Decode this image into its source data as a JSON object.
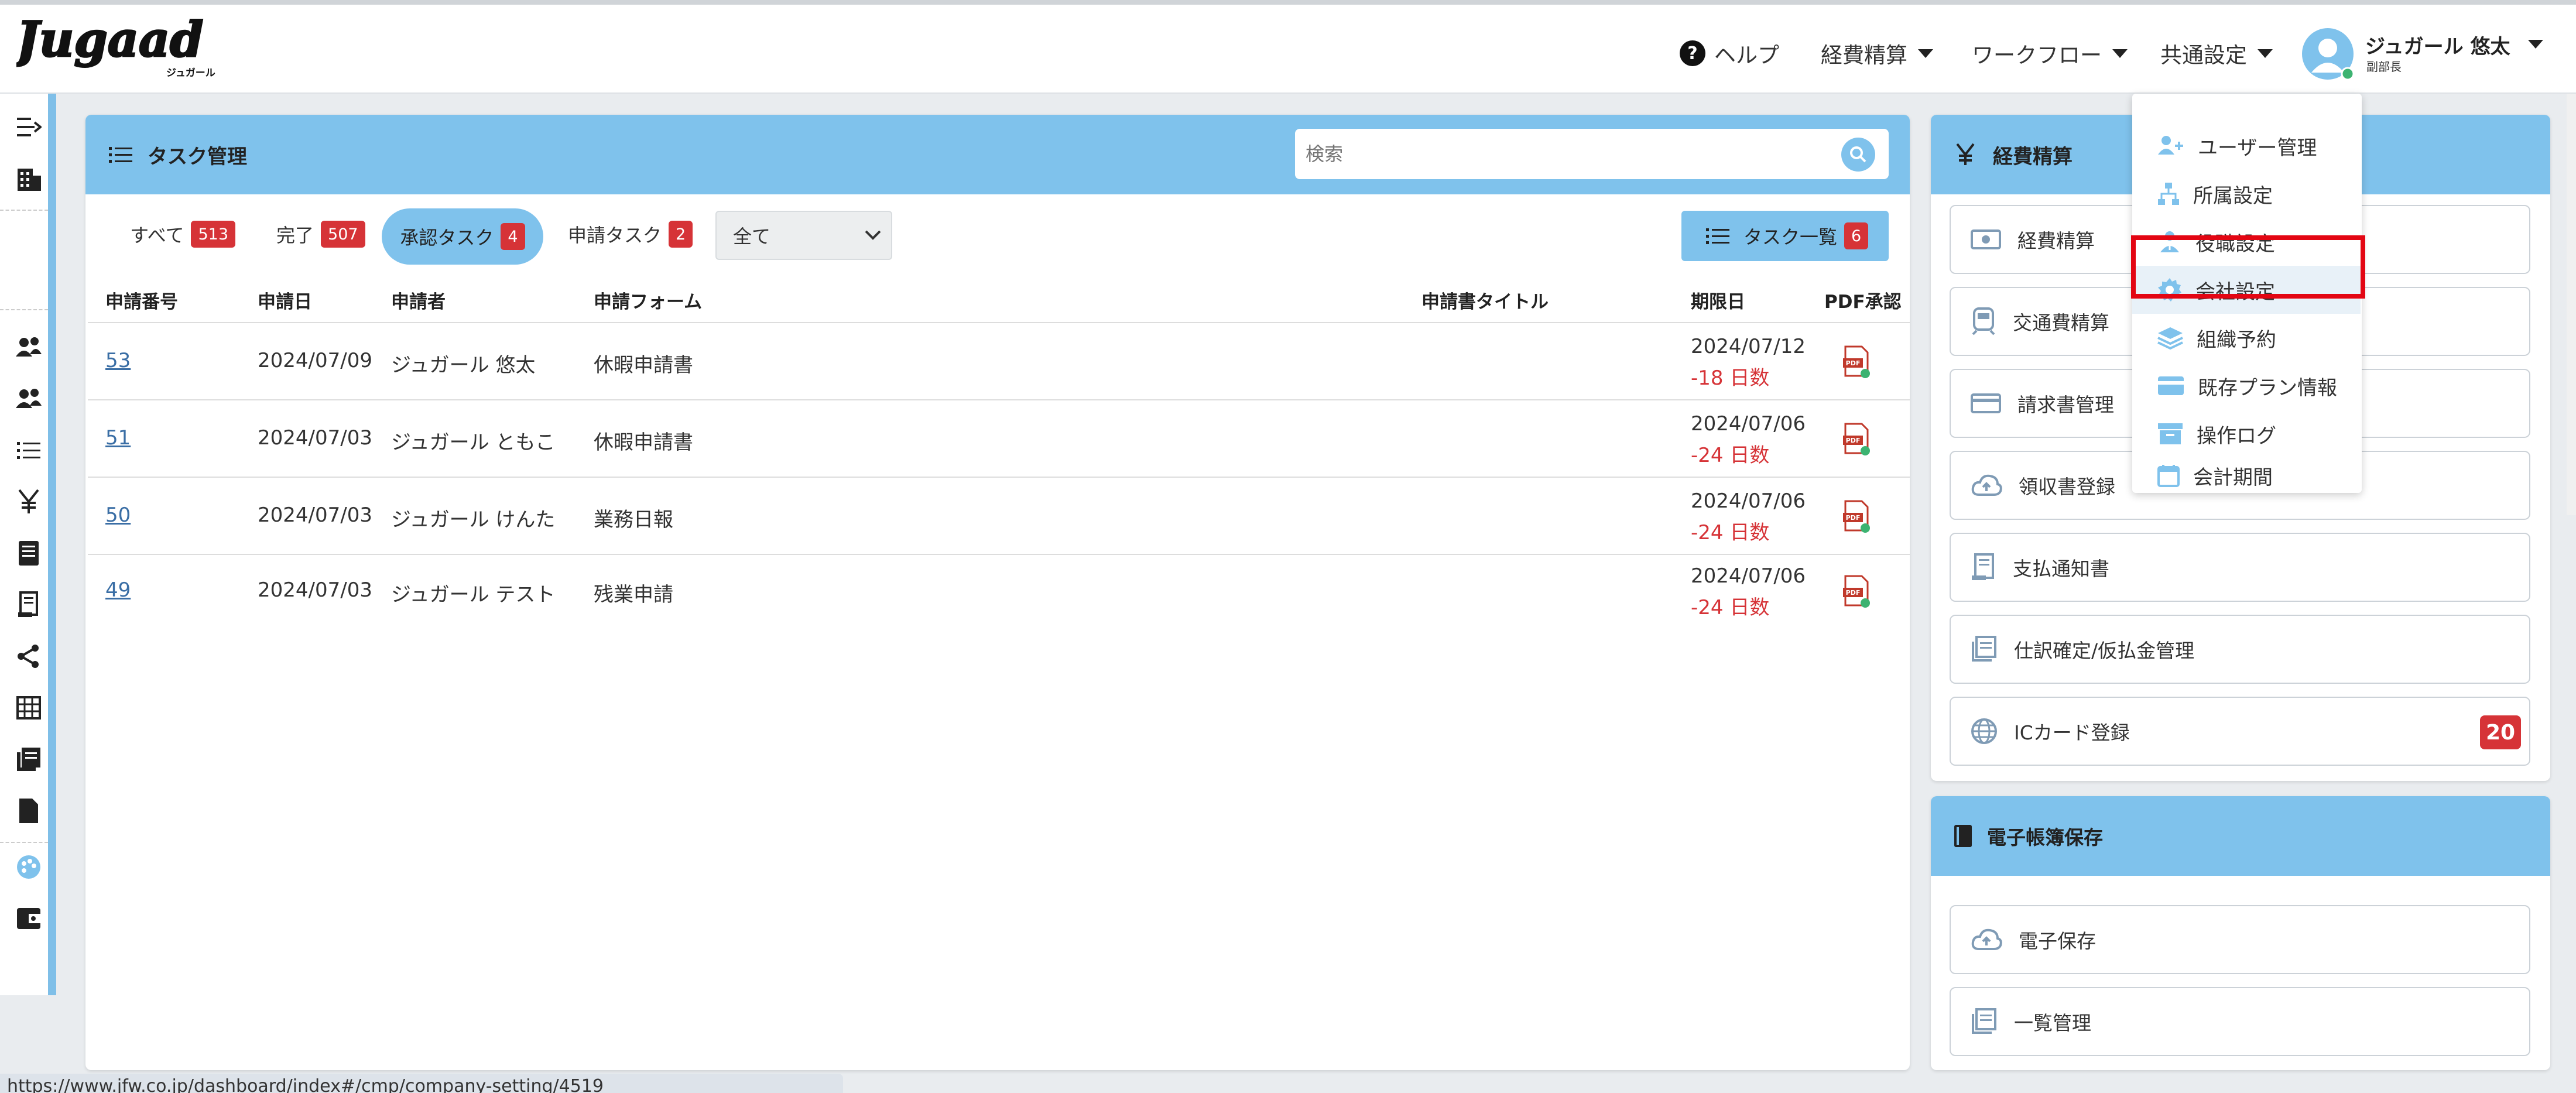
{
  "app": {
    "logo_text": "Jugaad",
    "logo_sub": "ジュガール"
  },
  "header": {
    "help": "ヘルプ",
    "menu_expense": "経費精算",
    "menu_workflow": "ワークフロー",
    "menu_common": "共通設定",
    "user_name": "ジュガール 悠太",
    "user_role": "副部長"
  },
  "dropdown": {
    "items": [
      "ユーザー管理",
      "所属設定",
      "役職設定",
      "会社設定",
      "組織予約",
      "既存プラン情報",
      "操作ログ",
      "会計期間"
    ],
    "highlighted": "会社設定"
  },
  "task_panel": {
    "title": "タスク管理",
    "search_placeholder": "検索",
    "tabs": [
      {
        "label": "すべて",
        "count": "513"
      },
      {
        "label": "完了",
        "count": "507"
      },
      {
        "label": "承認タスク",
        "count": "4"
      },
      {
        "label": "申請タスク",
        "count": "2"
      }
    ],
    "filter_value": "全て",
    "list_button": "タスク一覧",
    "list_count": "6",
    "columns": [
      "申請番号",
      "申請日",
      "申請者",
      "申請フォーム",
      "申請書タイトル",
      "期限日",
      "PDF承認"
    ],
    "rows": [
      {
        "id": "53",
        "date": "2024/07/09",
        "applicant": "ジュガール 悠太",
        "form": "休暇申請書",
        "title": "",
        "due": "2024/07/12",
        "overdue": "-18 日数"
      },
      {
        "id": "51",
        "date": "2024/07/03",
        "applicant": "ジュガール ともこ",
        "form": "休暇申請書",
        "title": "",
        "due": "2024/07/06",
        "overdue": "-24 日数"
      },
      {
        "id": "50",
        "date": "2024/07/03",
        "applicant": "ジュガール けんた",
        "form": "業務日報",
        "title": "",
        "due": "2024/07/06",
        "overdue": "-24 日数"
      },
      {
        "id": "49",
        "date": "2024/07/03",
        "applicant": "ジュガール テスト",
        "form": "残業申請",
        "title": "",
        "due": "2024/07/06",
        "overdue": "-24 日数"
      }
    ]
  },
  "expense_panel": {
    "title": "経費精算",
    "items": [
      "経費精算",
      "交通費精算",
      "請求書管理",
      "領収書登録",
      "支払通知書",
      "仕訳確定/仮払金管理",
      "ICカード登録"
    ],
    "ic_count": "20"
  },
  "ebook_panel": {
    "title": "電子帳簿保存",
    "items": [
      "電子保存",
      "一覧管理"
    ]
  },
  "status_url": "https://www.jfw.co.jp/dashboard/index#/cmp/company-setting/4519",
  "colors": {
    "accent": "#7fc2ec",
    "badge": "#d63337",
    "highlight_box": "#e30613"
  }
}
